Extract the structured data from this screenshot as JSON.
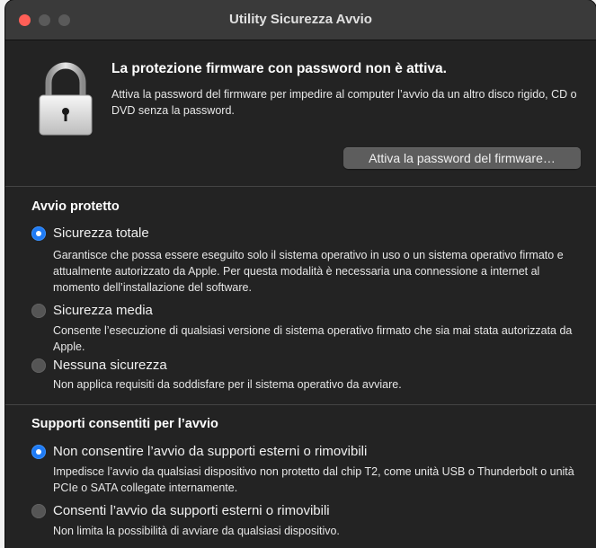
{
  "window": {
    "title": "Utility Sicurezza Avvio"
  },
  "firmware": {
    "headline": "La protezione firmware con password non è attiva.",
    "description": "Attiva la password del firmware per impedire al computer l’avvio da un altro disco rigido, CD o DVD senza la password.",
    "button_label": "Attiva la password del firmware…",
    "icon": "padlock-icon"
  },
  "secure_boot": {
    "title": "Avvio protetto",
    "options": [
      {
        "label": "Sicurezza totale",
        "selected": true,
        "description": "Garantisce che possa essere eseguito solo il sistema operativo in uso o un sistema operativo firmato e attualmente autorizzato da Apple. Per questa modalità è necessaria una connessione a internet al momento dell’installazione del software."
      },
      {
        "label": "Sicurezza media",
        "selected": false,
        "description": "Consente l’esecuzione di qualsiasi versione di sistema operativo firmato che sia mai stata autorizzata da Apple."
      },
      {
        "label": "Nessuna sicurezza",
        "selected": false,
        "description": "Non applica requisiti da soddisfare per il sistema operativo da avviare."
      }
    ]
  },
  "boot_media": {
    "title": "Supporti consentiti per l’avvio",
    "options": [
      {
        "label": "Non consentire l’avvio da supporti esterni o rimovibili",
        "selected": true,
        "description": "Impedisce l’avvio da qualsiasi dispositivo non protetto dal chip T2, come unità USB o Thunderbolt o unità PCIe o SATA collegate internamente."
      },
      {
        "label": "Consenti l’avvio da supporti esterni o rimovibili",
        "selected": false,
        "description": "Non limita la possibilità di avviare da qualsiasi dispositivo."
      }
    ]
  },
  "colors": {
    "accent": "#1f7bf5",
    "close": "#ff5f57",
    "background": "#232323"
  }
}
